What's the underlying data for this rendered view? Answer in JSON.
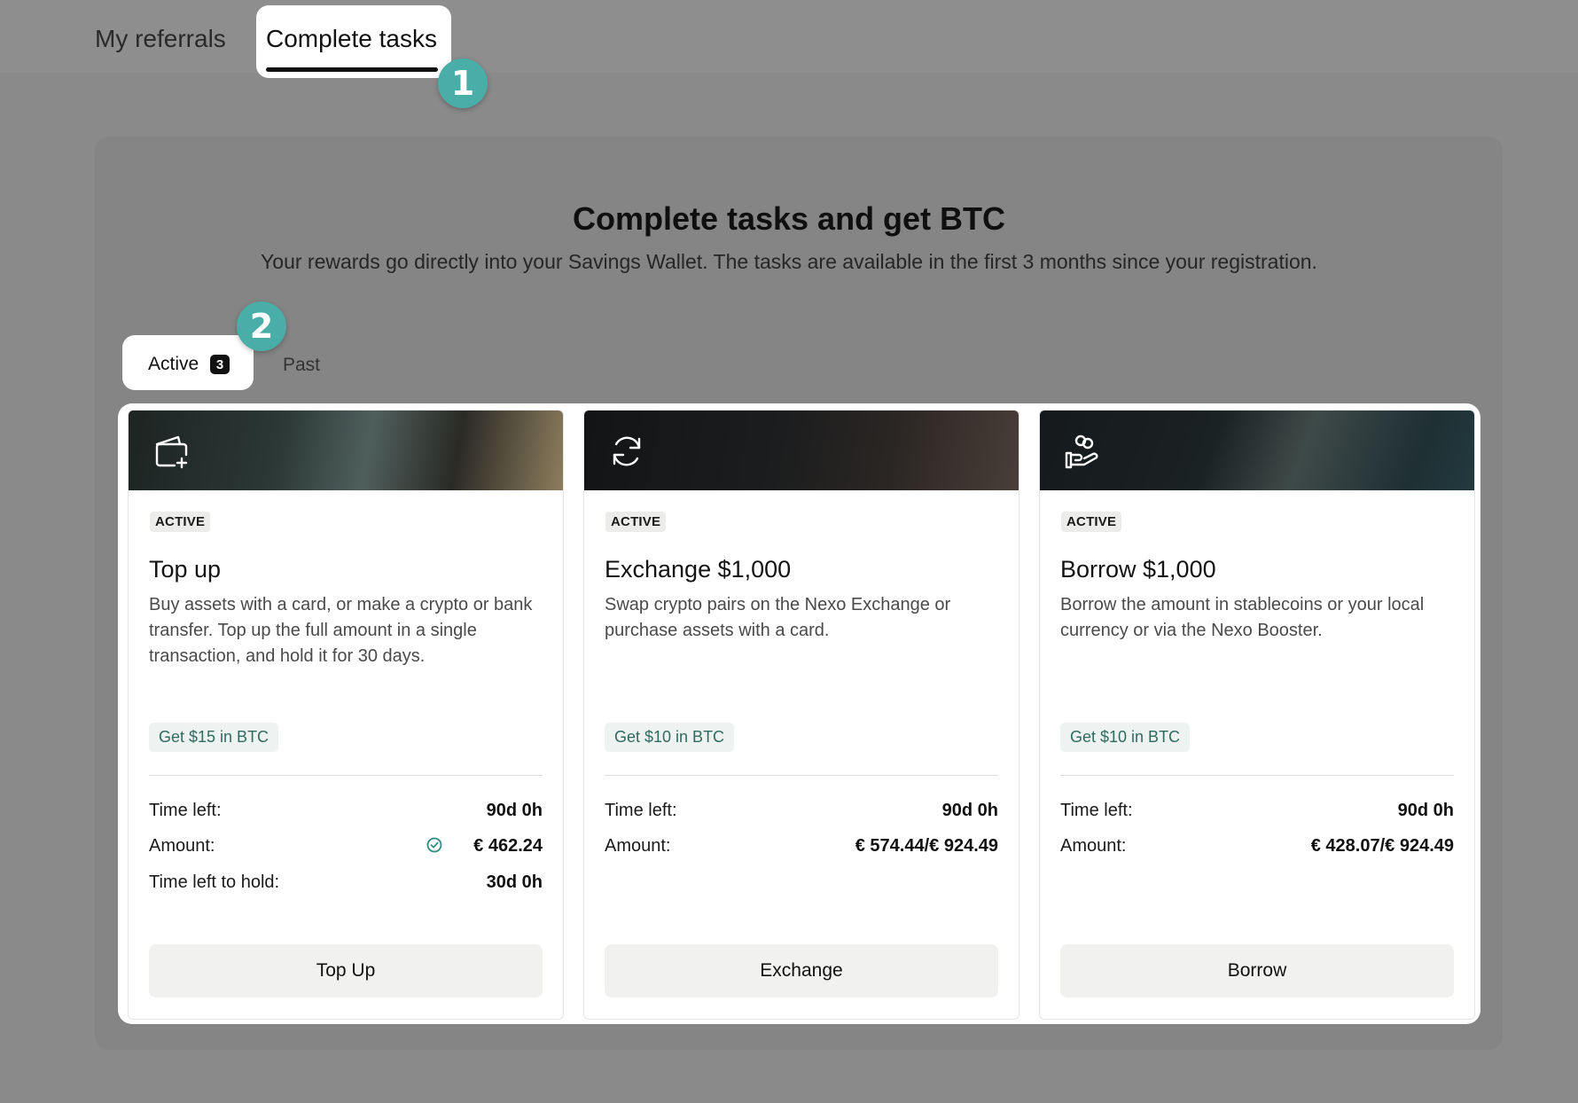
{
  "tabs": {
    "my_referrals": "My referrals",
    "complete_tasks": "Complete tasks"
  },
  "steps": {
    "one": "1",
    "two": "2"
  },
  "header": {
    "title": "Complete tasks and get BTC",
    "subtitle": "Your rewards go directly into your Savings Wallet. The tasks are available in the first 3 months since your registration."
  },
  "filter": {
    "active_label": "Active",
    "active_count": "3",
    "past_label": "Past"
  },
  "cards": [
    {
      "icon": "wallet-plus-icon",
      "status": "ACTIVE",
      "title": "Top up",
      "description": "Buy assets with a card, or make a crypto or bank transfer. Top up the full amount in a single transaction, and hold it for 30 days.",
      "reward": "Get $15 in BTC",
      "time_left_label": "Time left:",
      "time_left": "90d 0h",
      "amount_label": "Amount:",
      "amount": "€ 462.24",
      "hold_label": "Time left to hold:",
      "hold": "30d 0h",
      "button": "Top Up"
    },
    {
      "icon": "exchange-arrows-icon",
      "status": "ACTIVE",
      "title": "Exchange $1,000",
      "description": "Swap crypto pairs on the Nexo Exchange or purchase assets with a card.",
      "reward": "Get $10 in BTC",
      "time_left_label": "Time left:",
      "time_left": "90d 0h",
      "amount_label": "Amount:",
      "amount": "€ 574.44/€ 924.49",
      "button": "Exchange"
    },
    {
      "icon": "hand-coins-icon",
      "status": "ACTIVE",
      "title": "Borrow $1,000",
      "description": "Borrow the amount in stablecoins or your local currency or via the Nexo Booster.",
      "reward": "Get $10 in BTC",
      "time_left_label": "Time left:",
      "time_left": "90d 0h",
      "amount_label": "Amount:",
      "amount": "€ 428.07/€ 924.49",
      "button": "Borrow"
    }
  ],
  "colors": {
    "accent_step": "#4aaea8",
    "reward_text": "#2f6a5e",
    "overlay": "#8a8a8a"
  }
}
